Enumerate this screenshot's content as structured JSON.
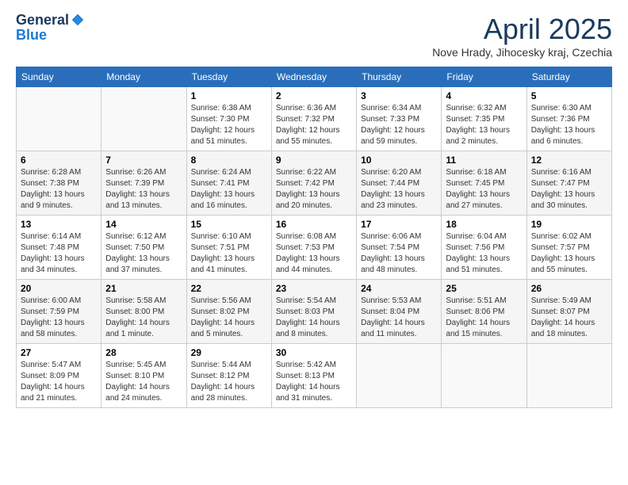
{
  "logo": {
    "general": "General",
    "blue": "Blue"
  },
  "header": {
    "title": "April 2025",
    "location": "Nove Hrady, Jihocesky kraj, Czechia"
  },
  "weekdays": [
    "Sunday",
    "Monday",
    "Tuesday",
    "Wednesday",
    "Thursday",
    "Friday",
    "Saturday"
  ],
  "weeks": [
    [
      {
        "day": "",
        "info": ""
      },
      {
        "day": "",
        "info": ""
      },
      {
        "day": "1",
        "info": "Sunrise: 6:38 AM\nSunset: 7:30 PM\nDaylight: 12 hours and 51 minutes."
      },
      {
        "day": "2",
        "info": "Sunrise: 6:36 AM\nSunset: 7:32 PM\nDaylight: 12 hours and 55 minutes."
      },
      {
        "day": "3",
        "info": "Sunrise: 6:34 AM\nSunset: 7:33 PM\nDaylight: 12 hours and 59 minutes."
      },
      {
        "day": "4",
        "info": "Sunrise: 6:32 AM\nSunset: 7:35 PM\nDaylight: 13 hours and 2 minutes."
      },
      {
        "day": "5",
        "info": "Sunrise: 6:30 AM\nSunset: 7:36 PM\nDaylight: 13 hours and 6 minutes."
      }
    ],
    [
      {
        "day": "6",
        "info": "Sunrise: 6:28 AM\nSunset: 7:38 PM\nDaylight: 13 hours and 9 minutes."
      },
      {
        "day": "7",
        "info": "Sunrise: 6:26 AM\nSunset: 7:39 PM\nDaylight: 13 hours and 13 minutes."
      },
      {
        "day": "8",
        "info": "Sunrise: 6:24 AM\nSunset: 7:41 PM\nDaylight: 13 hours and 16 minutes."
      },
      {
        "day": "9",
        "info": "Sunrise: 6:22 AM\nSunset: 7:42 PM\nDaylight: 13 hours and 20 minutes."
      },
      {
        "day": "10",
        "info": "Sunrise: 6:20 AM\nSunset: 7:44 PM\nDaylight: 13 hours and 23 minutes."
      },
      {
        "day": "11",
        "info": "Sunrise: 6:18 AM\nSunset: 7:45 PM\nDaylight: 13 hours and 27 minutes."
      },
      {
        "day": "12",
        "info": "Sunrise: 6:16 AM\nSunset: 7:47 PM\nDaylight: 13 hours and 30 minutes."
      }
    ],
    [
      {
        "day": "13",
        "info": "Sunrise: 6:14 AM\nSunset: 7:48 PM\nDaylight: 13 hours and 34 minutes."
      },
      {
        "day": "14",
        "info": "Sunrise: 6:12 AM\nSunset: 7:50 PM\nDaylight: 13 hours and 37 minutes."
      },
      {
        "day": "15",
        "info": "Sunrise: 6:10 AM\nSunset: 7:51 PM\nDaylight: 13 hours and 41 minutes."
      },
      {
        "day": "16",
        "info": "Sunrise: 6:08 AM\nSunset: 7:53 PM\nDaylight: 13 hours and 44 minutes."
      },
      {
        "day": "17",
        "info": "Sunrise: 6:06 AM\nSunset: 7:54 PM\nDaylight: 13 hours and 48 minutes."
      },
      {
        "day": "18",
        "info": "Sunrise: 6:04 AM\nSunset: 7:56 PM\nDaylight: 13 hours and 51 minutes."
      },
      {
        "day": "19",
        "info": "Sunrise: 6:02 AM\nSunset: 7:57 PM\nDaylight: 13 hours and 55 minutes."
      }
    ],
    [
      {
        "day": "20",
        "info": "Sunrise: 6:00 AM\nSunset: 7:59 PM\nDaylight: 13 hours and 58 minutes."
      },
      {
        "day": "21",
        "info": "Sunrise: 5:58 AM\nSunset: 8:00 PM\nDaylight: 14 hours and 1 minute."
      },
      {
        "day": "22",
        "info": "Sunrise: 5:56 AM\nSunset: 8:02 PM\nDaylight: 14 hours and 5 minutes."
      },
      {
        "day": "23",
        "info": "Sunrise: 5:54 AM\nSunset: 8:03 PM\nDaylight: 14 hours and 8 minutes."
      },
      {
        "day": "24",
        "info": "Sunrise: 5:53 AM\nSunset: 8:04 PM\nDaylight: 14 hours and 11 minutes."
      },
      {
        "day": "25",
        "info": "Sunrise: 5:51 AM\nSunset: 8:06 PM\nDaylight: 14 hours and 15 minutes."
      },
      {
        "day": "26",
        "info": "Sunrise: 5:49 AM\nSunset: 8:07 PM\nDaylight: 14 hours and 18 minutes."
      }
    ],
    [
      {
        "day": "27",
        "info": "Sunrise: 5:47 AM\nSunset: 8:09 PM\nDaylight: 14 hours and 21 minutes."
      },
      {
        "day": "28",
        "info": "Sunrise: 5:45 AM\nSunset: 8:10 PM\nDaylight: 14 hours and 24 minutes."
      },
      {
        "day": "29",
        "info": "Sunrise: 5:44 AM\nSunset: 8:12 PM\nDaylight: 14 hours and 28 minutes."
      },
      {
        "day": "30",
        "info": "Sunrise: 5:42 AM\nSunset: 8:13 PM\nDaylight: 14 hours and 31 minutes."
      },
      {
        "day": "",
        "info": ""
      },
      {
        "day": "",
        "info": ""
      },
      {
        "day": "",
        "info": ""
      }
    ]
  ]
}
